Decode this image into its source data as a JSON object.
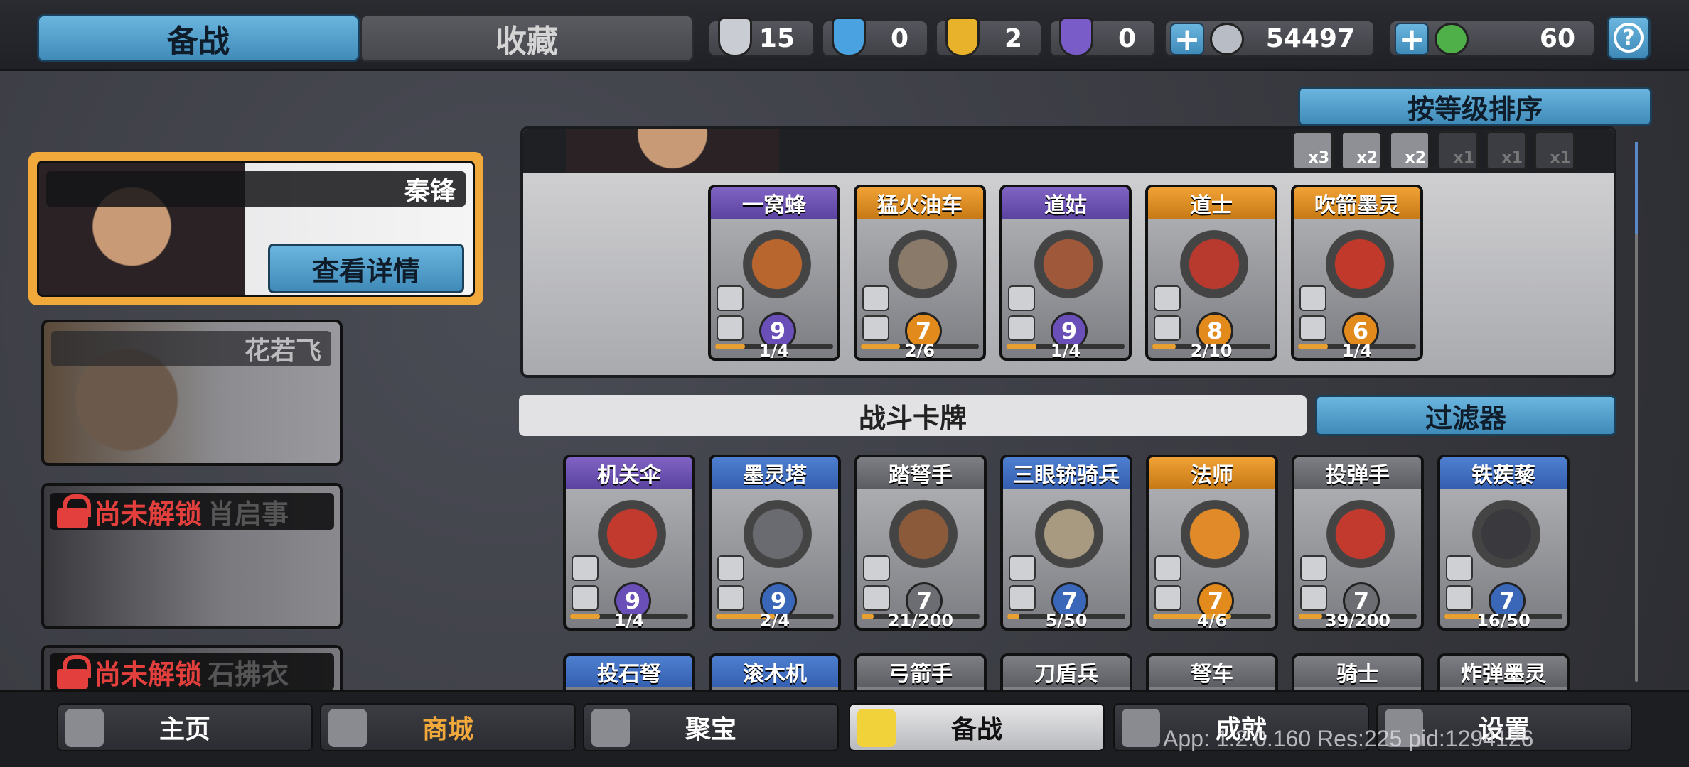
{
  "top_tabs": {
    "prep": "备战",
    "collection": "收藏"
  },
  "currencies": [
    {
      "name": "silver-shield",
      "value": "15",
      "color": "#c9ccd2"
    },
    {
      "name": "blue-crystal",
      "value": "0",
      "color": "#4aa3e0"
    },
    {
      "name": "gold-shield",
      "value": "2",
      "color": "#e8b22a"
    },
    {
      "name": "purple-shield",
      "value": "0",
      "color": "#7a5cc8"
    }
  ],
  "silver_coins": {
    "value": "54497",
    "color": "#b8bcc4"
  },
  "jade": {
    "value": "60",
    "color": "#4fb04a"
  },
  "plus_label": "+",
  "help_label": "?",
  "sort_button": "按等级排序",
  "heroes": [
    {
      "name": "秦锋",
      "selected": true,
      "detail_button": "查看详情"
    },
    {
      "name": "花若飞",
      "selected": false
    },
    {
      "name": "肖启事",
      "locked": true,
      "lock_text": "尚未解锁"
    },
    {
      "name": "石拂衣",
      "locked": true,
      "lock_text": "尚未解锁"
    }
  ],
  "deck_stats": [
    "x3",
    "x2",
    "x2",
    "x1",
    "x1",
    "x1"
  ],
  "deck_cards": [
    {
      "name": "一窝蜂",
      "tier": "purple",
      "level": "9",
      "progress": "1/4",
      "fill": 0.25,
      "color": "#b8662e"
    },
    {
      "name": "猛火油车",
      "tier": "orange",
      "level": "7",
      "progress": "2/6",
      "fill": 0.33,
      "color": "#8a7a6a"
    },
    {
      "name": "道姑",
      "tier": "purple",
      "level": "9",
      "progress": "1/4",
      "fill": 0.25,
      "color": "#a0583a"
    },
    {
      "name": "道士",
      "tier": "orange",
      "level": "8",
      "progress": "2/10",
      "fill": 0.2,
      "color": "#b83a2e"
    },
    {
      "name": "吹箭墨灵",
      "tier": "orange",
      "level": "6",
      "progress": "1/4",
      "fill": 0.25,
      "color": "#c0392b"
    }
  ],
  "battle_cards_title": "战斗卡牌",
  "filter_button": "过滤器",
  "battle_cards": [
    {
      "name": "机关伞",
      "tier": "purple",
      "level": "9",
      "progress": "1/4",
      "fill": 0.25,
      "color": "#c23a2e"
    },
    {
      "name": "墨灵塔",
      "tier": "blue",
      "level": "9",
      "progress": "2/4",
      "fill": 0.5,
      "color": "#6a6b70"
    },
    {
      "name": "踏弩手",
      "tier": "gray",
      "level": "7",
      "progress": "21/200",
      "fill": 0.1,
      "color": "#8a5a3a"
    },
    {
      "name": "三眼铳骑兵",
      "tier": "blue",
      "level": "7",
      "progress": "5/50",
      "fill": 0.1,
      "color": "#a89a80"
    },
    {
      "name": "法师",
      "tier": "orange",
      "level": "7",
      "progress": "4/6",
      "fill": 0.66,
      "color": "#e08a2a"
    },
    {
      "name": "投弹手",
      "tier": "gray",
      "level": "7",
      "progress": "39/200",
      "fill": 0.2,
      "color": "#c23a2e"
    },
    {
      "name": "铁蒺藜",
      "tier": "blue",
      "level": "7",
      "progress": "16/50",
      "fill": 0.32,
      "color": "#3a3a3e"
    }
  ],
  "battle_cards_row2": [
    {
      "name": "投石弩",
      "tier": "blue"
    },
    {
      "name": "滚木机",
      "tier": "blue"
    },
    {
      "name": "弓箭手",
      "tier": "gray"
    },
    {
      "name": "刀盾兵",
      "tier": "gray"
    },
    {
      "name": "弩车",
      "tier": "gray"
    },
    {
      "name": "骑士",
      "tier": "gray"
    },
    {
      "name": "炸弹墨灵",
      "tier": "gray"
    }
  ],
  "nav": [
    {
      "label": "主页",
      "icon": "home-icon"
    },
    {
      "label": "商城",
      "icon": "shop-icon",
      "color": "#f2a93b"
    },
    {
      "label": "聚宝",
      "icon": "treasure-icon"
    },
    {
      "label": "备战",
      "icon": "deck-icon",
      "active": true
    },
    {
      "label": "成就",
      "icon": "achievement-icon"
    },
    {
      "label": "设置",
      "icon": "settings-icon"
    }
  ],
  "debug_text": "App: 1.2.0.160 Res:225 pid:1294126"
}
